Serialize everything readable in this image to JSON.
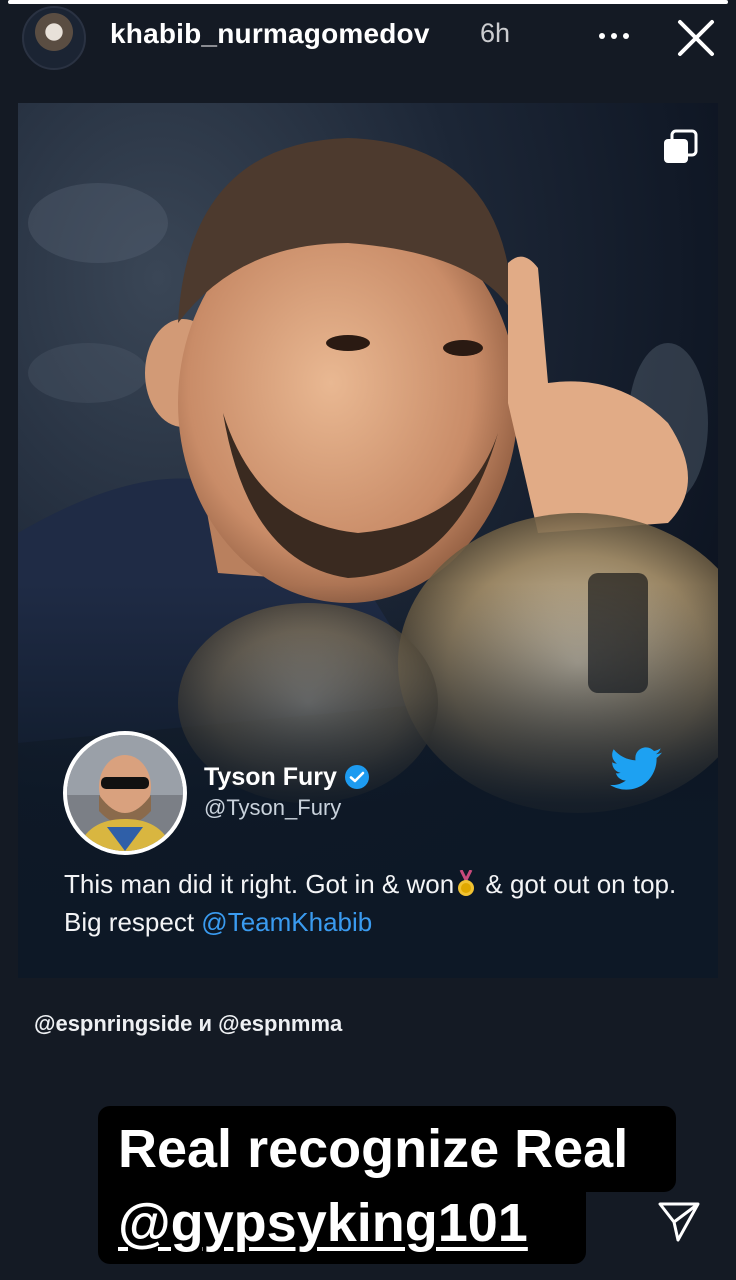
{
  "story": {
    "progress": 1.0,
    "username": "khabib_nurmagomedov",
    "time": "6h"
  },
  "tweet": {
    "name": "Tyson Fury",
    "handle": "@Tyson_Fury",
    "text_part1": "This man did it right. Got in & won",
    "text_part2": " & got out on top. Big respect ",
    "mention": "@TeamKhabib"
  },
  "credit": "@espnringside и @espnmma",
  "caption": {
    "line1": "Real recognize Real",
    "line2": "@gypsyking101"
  },
  "colors": {
    "background": "#141a24",
    "twitter_blue": "#1da1f2",
    "mention_blue": "#3a9bf0",
    "verified_blue": "#1d9bf0"
  },
  "icons": {
    "more": "more-horizontal-icon",
    "close": "close-icon",
    "multi": "multiple-images-icon",
    "verified": "verified-badge-icon",
    "twitter": "twitter-bird-icon",
    "send": "send-icon"
  }
}
